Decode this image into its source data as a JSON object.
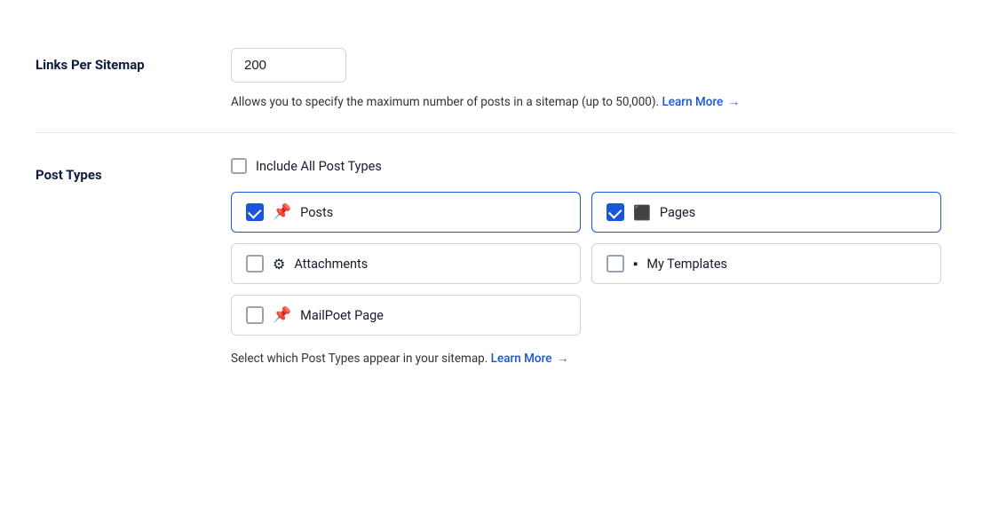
{
  "links_per_sitemap": {
    "label": "Links Per Sitemap",
    "value": "200",
    "help_text": "Allows you to specify the maximum number of posts in a sitemap (up to 50,000).",
    "learn_more_label": "Learn More",
    "learn_more_arrow": "→"
  },
  "post_types": {
    "label": "Post Types",
    "include_all_label": "Include All Post Types",
    "items": [
      {
        "id": "posts",
        "label": "Posts",
        "checked": true,
        "icon": "📌"
      },
      {
        "id": "pages",
        "label": "Pages",
        "checked": true,
        "icon": "🗋"
      },
      {
        "id": "attachments",
        "label": "Attachments",
        "checked": false,
        "icon": "⚙"
      },
      {
        "id": "my-templates",
        "label": "My Templates",
        "checked": false,
        "icon": "🗋"
      },
      {
        "id": "mailpoet-page",
        "label": "MailPoet Page",
        "checked": false,
        "icon": "📌"
      }
    ],
    "footer_text": "Select which Post Types appear in your sitemap.",
    "learn_more_label": "Learn More",
    "learn_more_arrow": "→"
  }
}
